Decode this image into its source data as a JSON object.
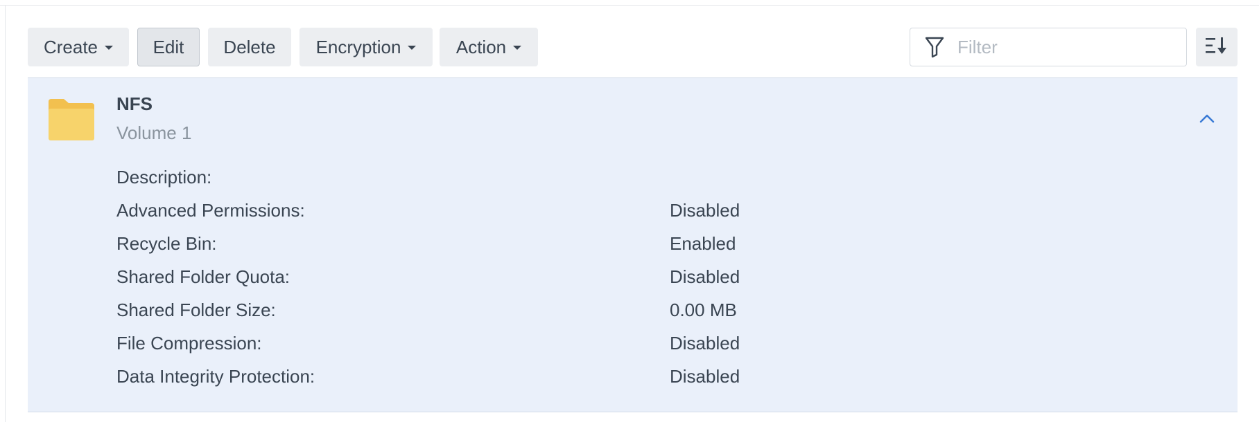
{
  "toolbar": {
    "create_label": "Create",
    "edit_label": "Edit",
    "delete_label": "Delete",
    "encryption_label": "Encryption",
    "action_label": "Action",
    "filter_placeholder": "Filter"
  },
  "folder": {
    "name": "NFS",
    "volume": "Volume 1",
    "icon": "folder-icon",
    "properties": [
      {
        "label": "Description:",
        "value": ""
      },
      {
        "label": "Advanced Permissions:",
        "value": "Disabled"
      },
      {
        "label": "Recycle Bin:",
        "value": "Enabled"
      },
      {
        "label": "Shared Folder Quota:",
        "value": "Disabled"
      },
      {
        "label": "Shared Folder Size:",
        "value": "0.00 MB"
      },
      {
        "label": "File Compression:",
        "value": "Disabled"
      },
      {
        "label": "Data Integrity Protection:",
        "value": "Disabled"
      }
    ]
  },
  "colors": {
    "panel_background": "#eaf0fa",
    "folder_yellow": "#f7d36b",
    "accent_blue": "#3a7bd5"
  }
}
